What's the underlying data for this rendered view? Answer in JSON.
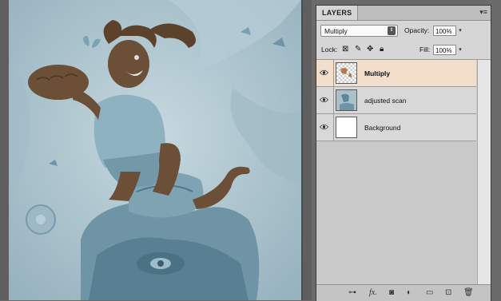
{
  "layers_panel": {
    "tab_label": "LAYERS",
    "menu_icon": "panel-menu-icon",
    "blend_mode": "Multiply",
    "opacity_label": "Opacity:",
    "opacity_value": "100%",
    "lock_label": "Lock:",
    "fill_label": "Fill:",
    "fill_value": "100%",
    "layers": [
      {
        "name": "Multiply",
        "selected": true,
        "visible": true
      },
      {
        "name": "adjusted scan",
        "selected": false,
        "visible": true
      },
      {
        "name": "Background",
        "selected": false,
        "visible": true
      }
    ],
    "bottom_icons": [
      "link-layers-icon",
      "fx-icon",
      "layer-mask-icon",
      "adjustment-layer-icon",
      "new-group-icon",
      "new-layer-icon",
      "trash-icon"
    ],
    "lock_icons": [
      "lock-transparent-icon",
      "lock-brush-icon",
      "lock-move-icon",
      "lock-all-icon"
    ]
  },
  "colors": {
    "selected_layer": "#f2decb",
    "artwork_bg": "#a9c1cb",
    "figure_brown": "#6b4f36"
  }
}
